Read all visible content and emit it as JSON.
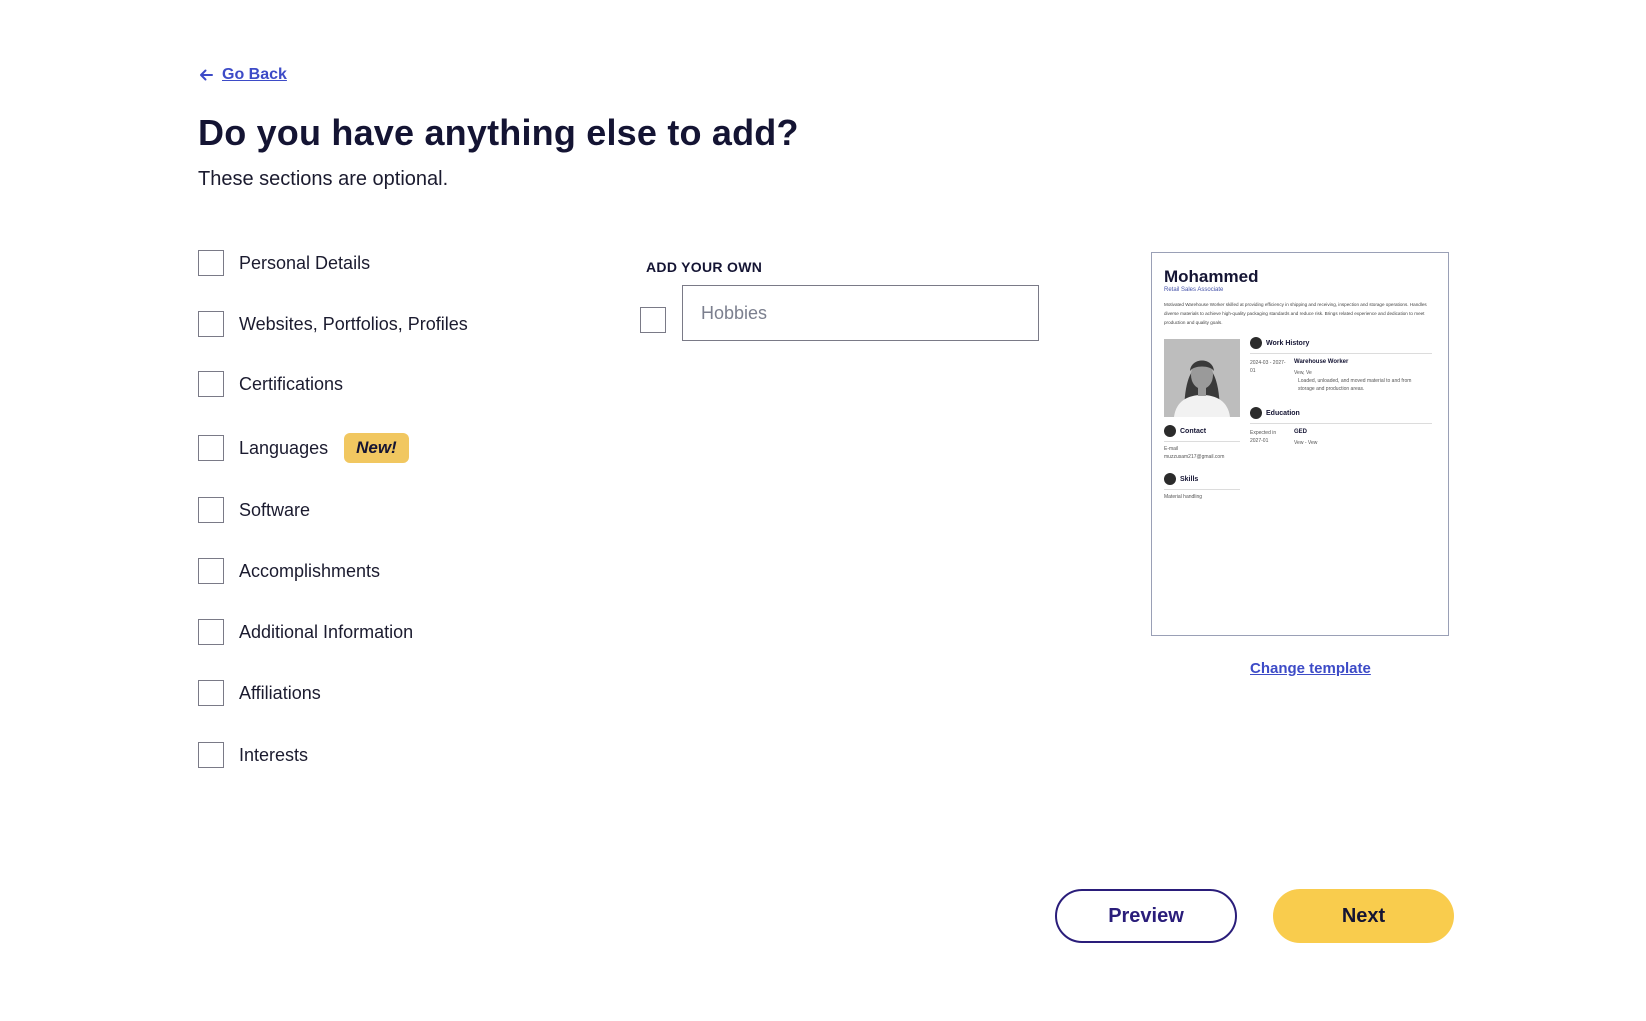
{
  "nav": {
    "go_back_label": "Go Back",
    "back_icon": "arrow-left-icon"
  },
  "header": {
    "title": "Do you have anything else to add?",
    "subtitle": "These sections are optional."
  },
  "options": [
    {
      "label": "Personal Details",
      "checked": false
    },
    {
      "label": "Websites, Portfolios, Profiles",
      "checked": false
    },
    {
      "label": "Certifications",
      "checked": false
    },
    {
      "label": "Languages",
      "checked": false,
      "badge": "New!"
    },
    {
      "label": "Software",
      "checked": false
    },
    {
      "label": "Accomplishments",
      "checked": false
    },
    {
      "label": "Additional Information",
      "checked": false
    },
    {
      "label": "Affiliations",
      "checked": false
    },
    {
      "label": "Interests",
      "checked": false
    }
  ],
  "add_own": {
    "heading": "ADD YOUR OWN",
    "placeholder": "Hobbies",
    "value": "",
    "checked": false
  },
  "resume_preview": {
    "name": "Mohammed",
    "role": "Retail Sales Associate",
    "summary": "Motivated Warehouse Worker skilled at providing efficiency in shipping and receiving, inspection and storage operations. Handles diverse materials to achieve high-quality packaging standards and reduce risk. Brings related experience and dedication to meet production and quality goals.",
    "sections": {
      "work_history": "Work History",
      "education": "Education",
      "contact": "Contact",
      "skills": "Skills"
    },
    "work": {
      "dates": "2024-03 - 2027-01",
      "title": "Warehouse Worker",
      "location": "Vew, Ve",
      "bullet": "Loaded, unloaded, and moved material to and from storage and production areas."
    },
    "education_entry": {
      "dates": "Expected in 2027-01",
      "degree": "GED",
      "location": "Vew - Vew"
    },
    "contact_entry": {
      "label": "E-mail",
      "value": "muzzusam217@gmail.com"
    },
    "skills_entry": "Material handling"
  },
  "change_template_label": "Change template",
  "actions": {
    "preview_label": "Preview",
    "next_label": "Next"
  },
  "colors": {
    "link": "#3d4bc7",
    "badge": "#f1c760",
    "next_button": "#f9cc4d",
    "preview_border": "#2a1d7a"
  }
}
